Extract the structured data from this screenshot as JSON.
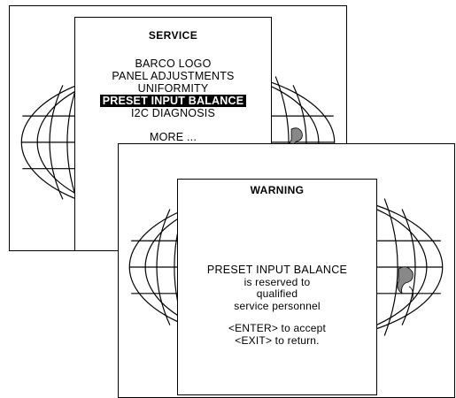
{
  "service_menu": {
    "title": "SERVICE",
    "items": [
      {
        "label": "BARCO LOGO"
      },
      {
        "label": "PANEL ADJUSTMENTS"
      },
      {
        "label": "UNIFORMITY"
      },
      {
        "label": "PRESET INPUT BALANCE",
        "selected": true
      },
      {
        "label": "I2C DIAGNOSIS"
      }
    ],
    "more_label": "MORE ..."
  },
  "warning": {
    "title": "WARNING",
    "heading": "PRESET INPUT BALANCE",
    "line1": "is reserved to",
    "line2": "qualified",
    "line3": "service personnel",
    "enter_hint": "<ENTER> to accept",
    "exit_hint": "<EXIT> to return."
  },
  "colors": {
    "frame": "#000000",
    "background": "#ffffff",
    "selection_bg": "#000000",
    "selection_fg": "#ffffff"
  },
  "icons": {
    "background": "globe-icon"
  }
}
